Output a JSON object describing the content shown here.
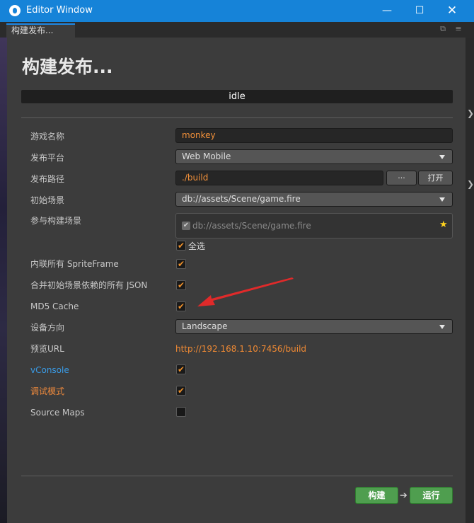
{
  "window": {
    "title": "Editor Window",
    "tab": "构建发布..."
  },
  "page": {
    "title": "构建发布...",
    "status": "idle"
  },
  "form": {
    "game_name": {
      "label": "游戏名称",
      "value": "monkey"
    },
    "platform": {
      "label": "发布平台",
      "value": "Web Mobile"
    },
    "path": {
      "label": "发布路径",
      "value": "./build",
      "browse": "···",
      "open": "打开"
    },
    "start_scene": {
      "label": "初始场景",
      "value": "db://assets/Scene/game.fire"
    },
    "scenes": {
      "label": "参与构建场景",
      "items": [
        "db://assets/Scene/game.fire"
      ],
      "select_all": "全选"
    },
    "inline_spriteframe": {
      "label": "内联所有 SpriteFrame",
      "checked": true
    },
    "merge_json": {
      "label": "合并初始场景依赖的所有 JSON",
      "checked": true
    },
    "md5": {
      "label": "MD5 Cache",
      "checked": true
    },
    "orientation": {
      "label": "设备方向",
      "value": "Landscape"
    },
    "preview_url": {
      "label": "预览URL",
      "value": "http://192.168.1.10:7456/build"
    },
    "vconsole": {
      "label": "vConsole",
      "checked": true
    },
    "debug": {
      "label": "调试模式",
      "checked": true
    },
    "source_maps": {
      "label": "Source Maps",
      "checked": false
    }
  },
  "actions": {
    "build": "构建",
    "run": "运行"
  },
  "colors": {
    "titlebar": "#1683d8",
    "accent_orange": "#f0912a",
    "link_blue": "#3a9be6",
    "button_green": "#4f9e4f",
    "annotation_red": "#e02a2a"
  }
}
